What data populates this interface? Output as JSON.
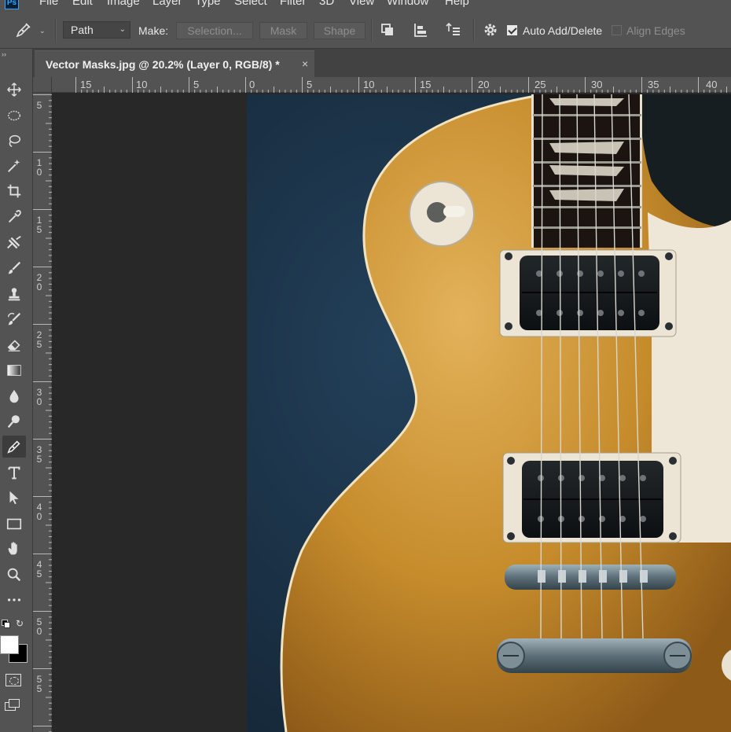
{
  "menubar": {
    "logo": "Ps",
    "items": [
      "File",
      "Edit",
      "Image",
      "Layer",
      "Type",
      "Select",
      "Filter",
      "3D",
      "View",
      "Window",
      "Help"
    ]
  },
  "options": {
    "mode_select": "Path",
    "make_label": "Make:",
    "selection_btn": "Selection...",
    "mask_btn": "Mask",
    "shape_btn": "Shape",
    "auto_add_delete": "Auto Add/Delete",
    "auto_add_delete_checked": true,
    "align_edges": "Align Edges",
    "align_edges_checked": false
  },
  "document": {
    "tab_title": "Vector Masks.jpg @ 20.2% (Layer 0, RGB/8) *",
    "close_glyph": "×"
  },
  "rulers": {
    "horizontal": [
      "15",
      "10",
      "5",
      "0",
      "5",
      "10",
      "15",
      "20",
      "25",
      "30",
      "35",
      "40"
    ],
    "vertical": [
      "5",
      "10",
      "15",
      "20",
      "25",
      "30",
      "35",
      "40",
      "45",
      "50",
      "55"
    ]
  },
  "tools": [
    {
      "name": "move-tool"
    },
    {
      "name": "elliptical-marquee-tool"
    },
    {
      "name": "lasso-tool"
    },
    {
      "name": "magic-wand-tool"
    },
    {
      "name": "crop-tool"
    },
    {
      "name": "eyedropper-tool"
    },
    {
      "name": "healing-brush-tool"
    },
    {
      "name": "brush-tool"
    },
    {
      "name": "clone-stamp-tool"
    },
    {
      "name": "history-brush-tool"
    },
    {
      "name": "eraser-tool"
    },
    {
      "name": "gradient-tool"
    },
    {
      "name": "blur-tool"
    },
    {
      "name": "dodge-tool"
    },
    {
      "name": "pen-tool",
      "active": true
    },
    {
      "name": "type-tool"
    },
    {
      "name": "path-selection-tool"
    },
    {
      "name": "rectangle-tool"
    },
    {
      "name": "hand-tool"
    },
    {
      "name": "zoom-tool"
    },
    {
      "name": "edit-toolbar"
    }
  ],
  "colors": {
    "ui_bg": "#535353",
    "pasteboard": "#282828",
    "photo_backdrop": "#1d3445",
    "guitar_gold": "#c8912e",
    "foreground": "#ffffff",
    "background": "#000000"
  }
}
